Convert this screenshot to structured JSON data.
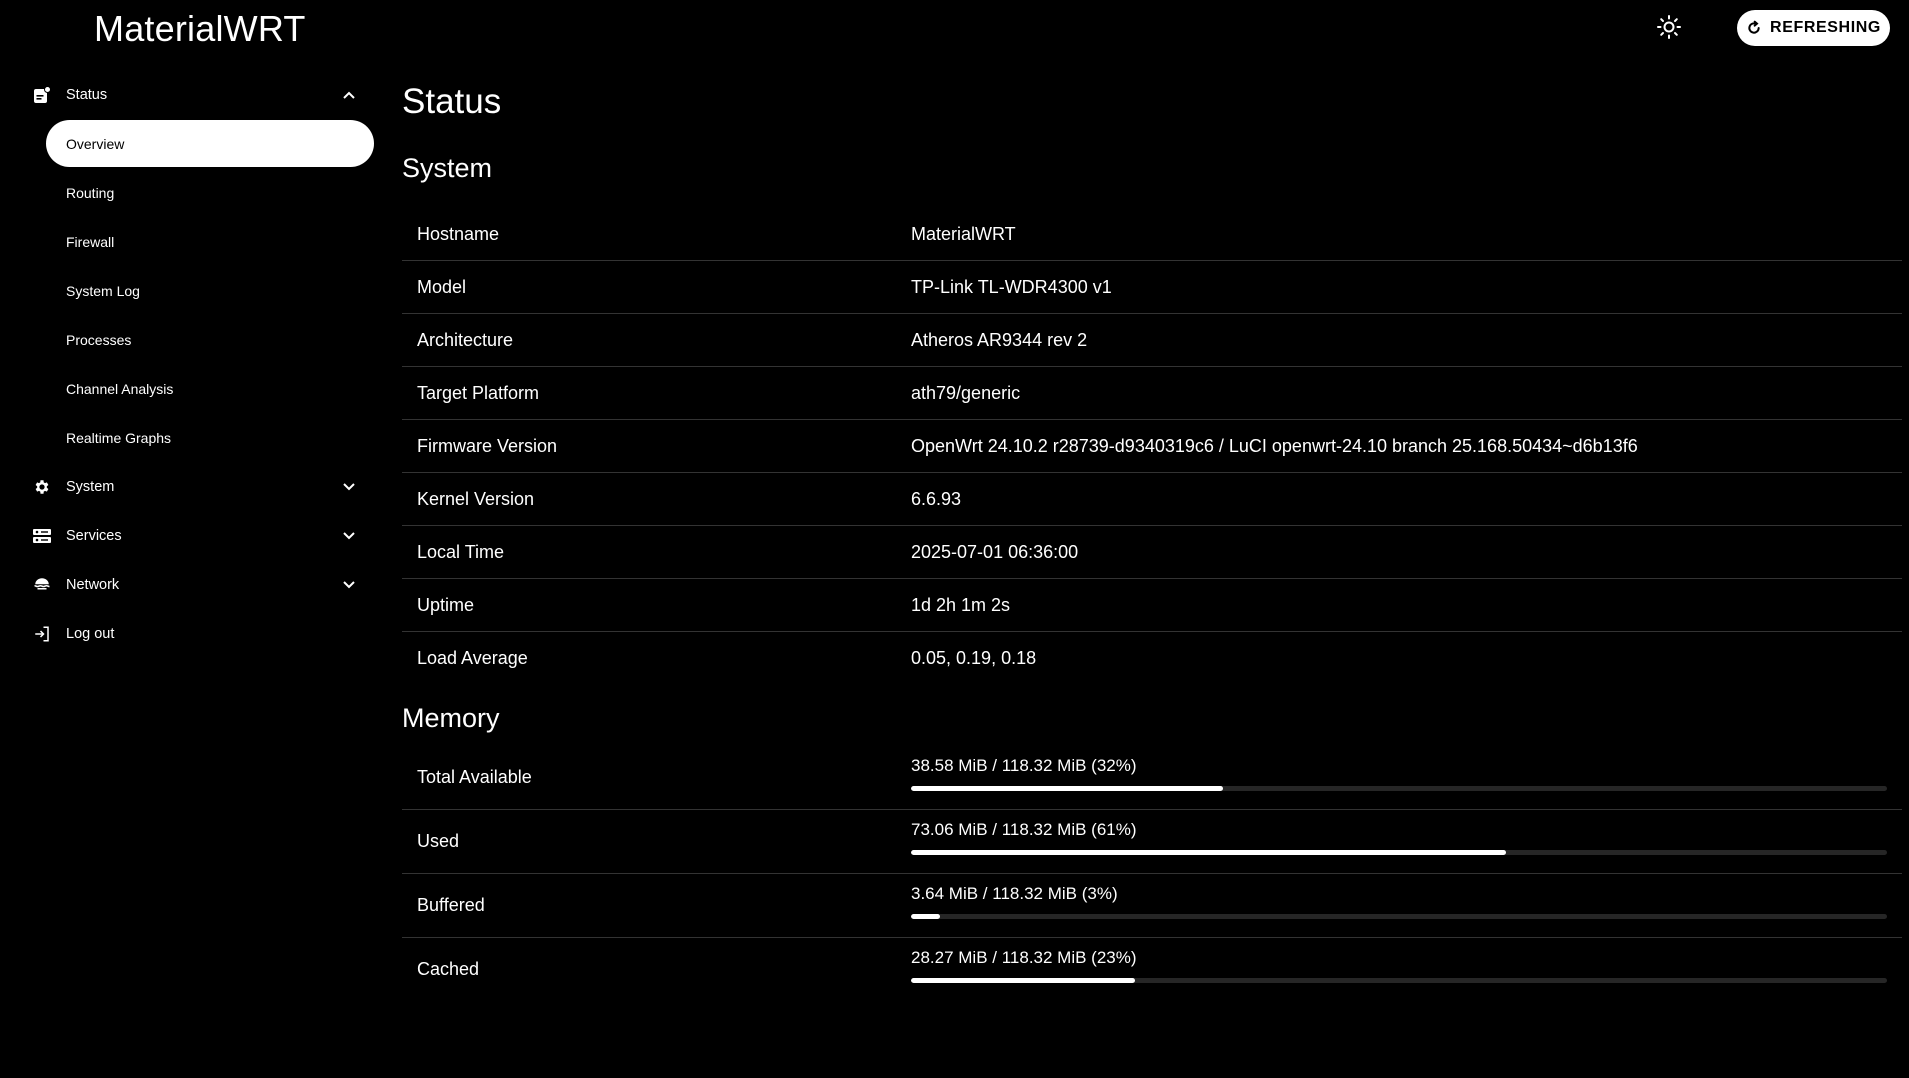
{
  "header": {
    "app_title": "MaterialWRT",
    "theme_toggle_icon": "sun-icon",
    "refresh_label": "REFRESHING",
    "refresh_icon": "refresh-icon"
  },
  "sidebar": {
    "groups": [
      {
        "label": "Status",
        "icon": "status-icon",
        "expanded": true,
        "items": [
          {
            "label": "Overview",
            "active": true
          },
          {
            "label": "Routing"
          },
          {
            "label": "Firewall"
          },
          {
            "label": "System Log"
          },
          {
            "label": "Processes"
          },
          {
            "label": "Channel Analysis"
          },
          {
            "label": "Realtime Graphs"
          }
        ]
      },
      {
        "label": "System",
        "icon": "gear-icon",
        "expanded": false
      },
      {
        "label": "Services",
        "icon": "services-icon",
        "expanded": false
      },
      {
        "label": "Network",
        "icon": "network-icon",
        "expanded": false
      },
      {
        "label": "Log out",
        "icon": "logout-icon"
      }
    ]
  },
  "main": {
    "page_title": "Status",
    "system": {
      "title": "System",
      "rows": [
        {
          "key": "Hostname",
          "value": "MaterialWRT"
        },
        {
          "key": "Model",
          "value": "TP-Link TL-WDR4300 v1"
        },
        {
          "key": "Architecture",
          "value": "Atheros AR9344 rev 2"
        },
        {
          "key": "Target Platform",
          "value": "ath79/generic"
        },
        {
          "key": "Firmware Version",
          "value": "OpenWrt 24.10.2 r28739-d9340319c6 / LuCI openwrt-24.10 branch 25.168.50434~d6b13f6"
        },
        {
          "key": "Kernel Version",
          "value": "6.6.93"
        },
        {
          "key": "Local Time",
          "value": "2025-07-01 06:36:00"
        },
        {
          "key": "Uptime",
          "value": "1d 2h 1m 2s"
        },
        {
          "key": "Load Average",
          "value": "0.05, 0.19, 0.18"
        }
      ]
    },
    "memory": {
      "title": "Memory",
      "rows": [
        {
          "key": "Total Available",
          "value": "38.58 MiB / 118.32 MiB (32%)",
          "percent": 32
        },
        {
          "key": "Used",
          "value": "73.06 MiB / 118.32 MiB (61%)",
          "percent": 61
        },
        {
          "key": "Buffered",
          "value": "3.64 MiB / 118.32 MiB (3%)",
          "percent": 3
        },
        {
          "key": "Cached",
          "value": "28.27 MiB / 118.32 MiB (23%)",
          "percent": 23
        }
      ]
    }
  }
}
